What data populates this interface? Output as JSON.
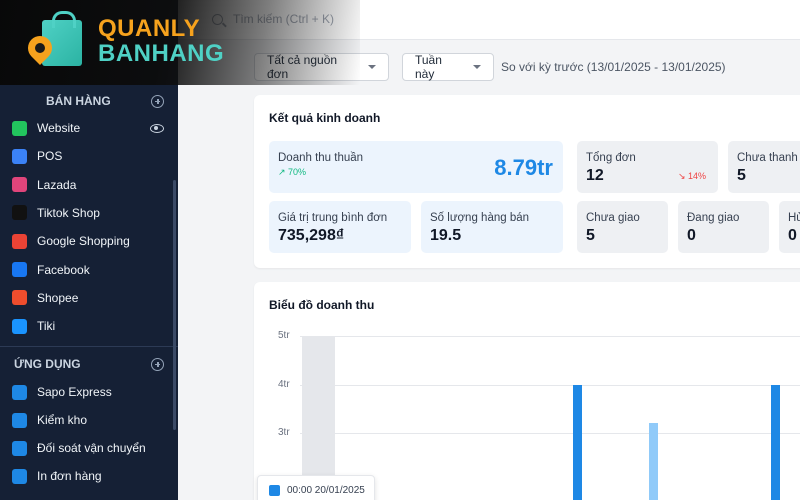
{
  "logo": {
    "line1": "QUANLY",
    "line2": "BANHANG"
  },
  "search": {
    "placeholder": "Tìm kiếm (Ctrl + K)"
  },
  "sidebar": {
    "sales_channels": {
      "title": "BÁN HÀNG",
      "items": [
        {
          "label": "Website",
          "icon": "website-icon",
          "color": "#22c55e"
        },
        {
          "label": "POS",
          "icon": "pos-icon",
          "color": "#3b82f6"
        },
        {
          "label": "Lazada",
          "icon": "lazada-icon",
          "color": "#e0457b"
        },
        {
          "label": "Tiktok Shop",
          "icon": "tiktok-icon",
          "color": "#111111"
        },
        {
          "label": "Google Shopping",
          "icon": "google-shopping-icon",
          "color": "#ea4335"
        },
        {
          "label": "Facebook",
          "icon": "facebook-icon",
          "color": "#1877f2"
        },
        {
          "label": "Shopee",
          "icon": "shopee-icon",
          "color": "#ee4d2d"
        },
        {
          "label": "Tiki",
          "icon": "tiki-icon",
          "color": "#1a94ff"
        }
      ]
    },
    "apps": {
      "title": "ỨNG DỤNG",
      "items": [
        {
          "label": "Sapo Express",
          "icon": "sapo-express-icon",
          "color": "#1e88e5"
        },
        {
          "label": "Kiểm kho",
          "icon": "inventory-icon",
          "color": "#1e88e5"
        },
        {
          "label": "Đối soát vận chuyển",
          "icon": "shipping-reconcile-icon",
          "color": "#1e88e5"
        },
        {
          "label": "In đơn hàng",
          "icon": "print-icon",
          "color": "#1e88e5"
        }
      ]
    }
  },
  "filters": {
    "source": "Tất cả nguồn đơn",
    "period": "Tuần này",
    "compare": "So với kỳ trước (13/01/2025 - 13/01/2025)"
  },
  "business_results": {
    "title": "Kết quả kinh doanh",
    "net_revenue": {
      "label": "Doanh thu thuần",
      "value": "8.79tr",
      "change": "↗ 70%"
    },
    "total_orders": {
      "label": "Tổng đơn",
      "value": "12",
      "change": "↘ 14%"
    },
    "unpaid": {
      "label": "Chưa thanh t",
      "value": "5"
    },
    "avg_order_value": {
      "label": "Giá trị trung bình đơn",
      "value": "735,298₫"
    },
    "items_sold": {
      "label": "Số lượng hàng bán",
      "value": "19.5"
    },
    "not_shipped": {
      "label": "Chưa giao",
      "value": "5"
    },
    "shipping": {
      "label": "Đang giao",
      "value": "0"
    },
    "cancelled": {
      "label": "Hủ",
      "value": "0"
    }
  },
  "revenue_chart": {
    "title": "Biểu đồ doanh thu",
    "tooltip": "00:00 20/01/2025"
  },
  "chart_data": {
    "type": "bar",
    "title": "Biểu đồ doanh thu",
    "y_ticks": [
      "5tr",
      "4tr",
      "3tr"
    ],
    "ylim": [
      0,
      5
    ],
    "series": [
      {
        "values": [
          4.0,
          3.2,
          4.0
        ]
      }
    ],
    "highlight_color": "#1e88e5",
    "secondary_color": "#90caf9"
  }
}
